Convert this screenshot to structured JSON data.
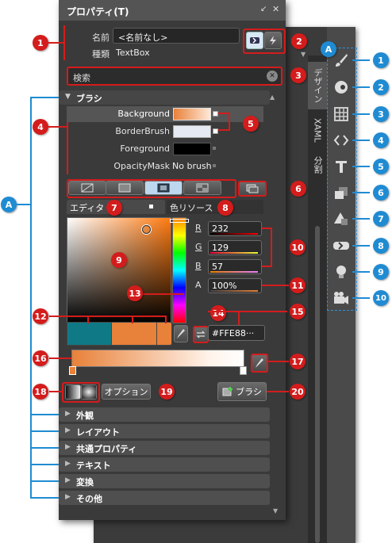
{
  "panel": {
    "title": "プロパティ(T)",
    "pin_icon": "pin-icon",
    "close_icon": "close-icon"
  },
  "object": {
    "name_label": "名前",
    "name_value": "<名前なし>",
    "type_label": "種類",
    "type_value": "TextBox"
  },
  "search": {
    "placeholder": "検索"
  },
  "brush_section": {
    "title": "ブラシ",
    "properties": [
      {
        "label": "Background",
        "value": ""
      },
      {
        "label": "BorderBrush",
        "value": ""
      },
      {
        "label": "Foreground",
        "value": ""
      },
      {
        "label": "OpacityMask",
        "value": "No brush"
      }
    ]
  },
  "editor": {
    "tab_editor": "エディタ",
    "tab_resources": "色リソース",
    "r_label": "R",
    "r_value": "232",
    "g_label": "G",
    "g_value": "129",
    "b_label": "B",
    "b_value": "57",
    "a_label": "A",
    "a_value": "100%",
    "hex_value": "#FFE88···",
    "options_label": "オプション",
    "brush_button_label": "ブラシ"
  },
  "collapsed_sections": [
    "外観",
    "レイアウト",
    "共通プロパティ",
    "テキスト",
    "変換",
    "その他"
  ],
  "side_tabs": [
    "デザイン",
    "XAML",
    "分割"
  ],
  "tools": [
    "brush-icon",
    "color-icon",
    "grid-icon",
    "code-icon",
    "text-icon",
    "layers-icon",
    "shapes-icon",
    "asset-icon",
    "light-bulb-icon",
    "camera-icon"
  ],
  "callouts": {
    "red": [
      "1",
      "2",
      "3",
      "4",
      "5",
      "6",
      "7",
      "8",
      "9",
      "10",
      "11",
      "12",
      "13",
      "14",
      "15",
      "16",
      "17",
      "18",
      "19",
      "20"
    ],
    "blue_panel": "A",
    "blue_tools": [
      "A",
      "1",
      "2",
      "3",
      "4",
      "5",
      "6",
      "7",
      "8",
      "9",
      "10"
    ]
  },
  "colors": {
    "accent_red": "#d41c1c",
    "accent_blue": "#1f8bd2",
    "brush_orange": "#e88139",
    "brush_teal": "#0f7a86"
  }
}
